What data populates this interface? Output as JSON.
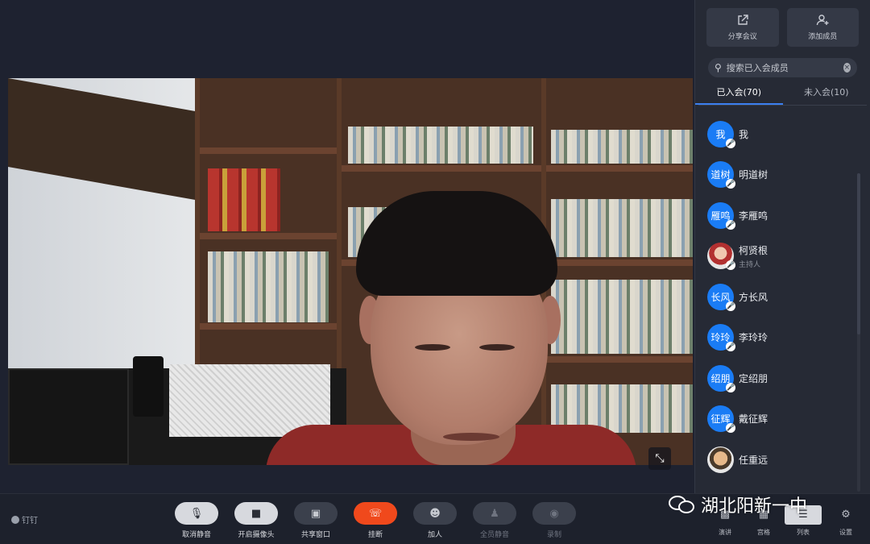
{
  "sidebar": {
    "share_label": "分享会议",
    "add_member_label": "添加成员",
    "search_placeholder": "搜索已入会成员",
    "tabs": [
      {
        "label": "已入会(70)"
      },
      {
        "label": "未入会(10)"
      }
    ],
    "members": [
      {
        "avatar_text": "我",
        "name": "我",
        "role": ""
      },
      {
        "avatar_text": "道树",
        "name": "明道树",
        "role": ""
      },
      {
        "avatar_text": "雁鸣",
        "name": "李雁鸣",
        "role": ""
      },
      {
        "avatar_text": "",
        "name": "柯贤根",
        "role": "主持人"
      },
      {
        "avatar_text": "长风",
        "name": "方长风",
        "role": ""
      },
      {
        "avatar_text": "玲玲",
        "name": "李玲玲",
        "role": ""
      },
      {
        "avatar_text": "绍朋",
        "name": "定绍朋",
        "role": ""
      },
      {
        "avatar_text": "征辉",
        "name": "戴征辉",
        "role": ""
      },
      {
        "avatar_text": "",
        "name": "任重远",
        "role": ""
      }
    ]
  },
  "toolbar": {
    "logo_text": "钉钉",
    "buttons": [
      {
        "label": "取消静音"
      },
      {
        "label": "开启摄像头"
      },
      {
        "label": "共享窗口"
      },
      {
        "label": "挂断"
      },
      {
        "label": "加人"
      },
      {
        "label": "全员静音"
      },
      {
        "label": "录制"
      }
    ],
    "right": [
      {
        "label": "演讲"
      },
      {
        "label": "宫格"
      },
      {
        "label": "列表"
      },
      {
        "label": "设置"
      }
    ]
  },
  "watermark": {
    "text": "湖北阳新一中"
  },
  "colors": {
    "accent": "#1a7cf5",
    "hangup": "#f0491c",
    "tab_active": "#3b7ff0"
  }
}
